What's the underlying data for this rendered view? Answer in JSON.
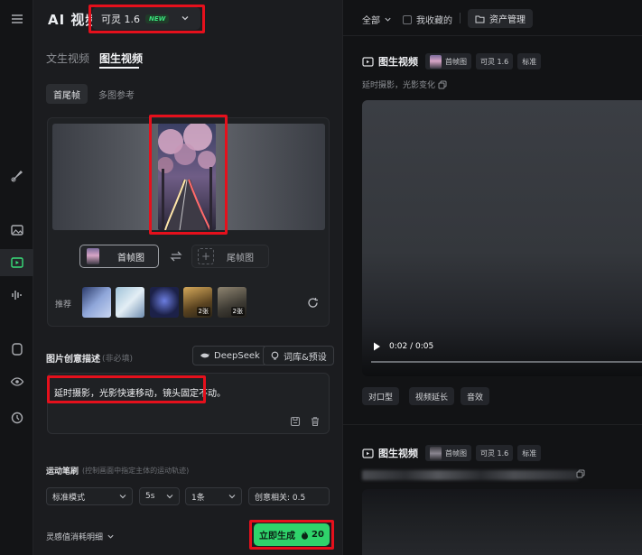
{
  "app": {
    "title": "AI 视频"
  },
  "model": {
    "name": "可灵 1.6",
    "badge": "NEW"
  },
  "tabs": [
    {
      "label": "文生视频",
      "active": false
    },
    {
      "label": "图生视频",
      "active": true
    }
  ],
  "subtabs": [
    {
      "label": "首尾帧",
      "active": true
    },
    {
      "label": "多图参考",
      "active": false
    }
  ],
  "frames": {
    "first_label": "首帧图",
    "last_label": "尾帧图"
  },
  "recommend": {
    "label": "推荐",
    "thumbs": [
      {
        "tag": ""
      },
      {
        "tag": ""
      },
      {
        "tag": ""
      },
      {
        "tag": "2张"
      },
      {
        "tag": "2张"
      }
    ]
  },
  "prompt": {
    "title": "图片创意描述",
    "optional": "(非必填)",
    "deepseek_label": "DeepSeek",
    "preset_label": "词库&预设",
    "text": "延时摄影，光影快速移动，镜头固定不动。"
  },
  "motion": {
    "title": "运动笔刷",
    "hint": "(控制画面中指定主体的运动轨迹)",
    "mode": "标准模式",
    "duration": "5s",
    "count": "1条",
    "relevance": "创意相关: 0.5"
  },
  "footer": {
    "cost_label": "灵感值消耗明细",
    "generate_label": "立即生成",
    "generate_cost": "20"
  },
  "right": {
    "filter_label": "全部",
    "favorites_label": "我收藏的",
    "assets_label": "资产管理",
    "items": [
      {
        "title": "图生视频",
        "tags": [
          "首帧图",
          "可灵 1.6",
          "标准"
        ],
        "subtitle": "延时摄影，光影变化",
        "time": "0:02 / 0:05",
        "actions": [
          "对口型",
          "视频延长",
          "音效"
        ]
      },
      {
        "title": "图生视频",
        "tags": [
          "首帧图",
          "可灵 1.6",
          "标准"
        ]
      }
    ]
  },
  "colors": {
    "accent": "#2fd36b",
    "highlight_box": "#e5101c",
    "panel": "#1b1c1f",
    "background": "#121315"
  },
  "icons": [
    "menu-icon",
    "brush-icon",
    "image-icon",
    "video-icon",
    "audio-icon",
    "box-icon",
    "eye-icon",
    "clock-icon",
    "refresh-icon",
    "swap-icon",
    "deepseek-icon",
    "bulb-icon",
    "save-icon",
    "trash-icon",
    "chevron-down-icon",
    "flame-icon",
    "folder-icon",
    "play-icon",
    "copy-icon"
  ]
}
